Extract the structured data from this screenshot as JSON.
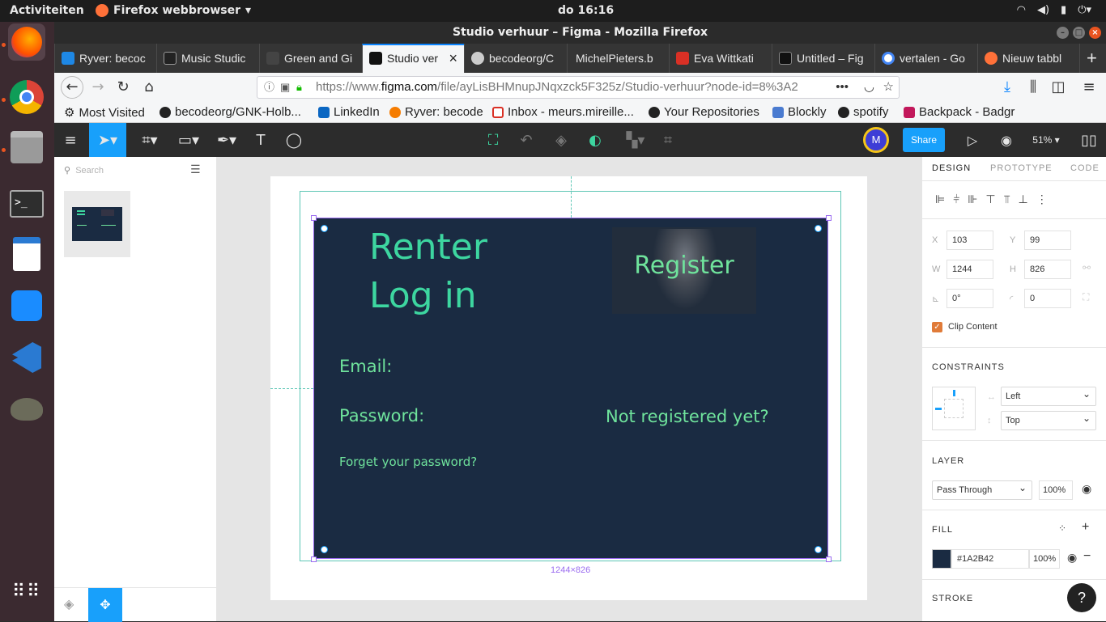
{
  "ubuntu": {
    "activities": "Activiteiten",
    "app_name": "Firefox webbrowser",
    "clock": "do 16:16"
  },
  "window": {
    "title": "Studio verhuur – Figma - Mozilla Firefox"
  },
  "tabs": [
    {
      "label": "Ryver: becoc",
      "color": "#1e88e5"
    },
    {
      "label": "Music Studic",
      "color": "#222222"
    },
    {
      "label": "Green and Gi",
      "color": "#444444"
    },
    {
      "label": "Studio ver",
      "color": "#111111",
      "active": true
    },
    {
      "label": "becodeorg/C",
      "color": "#cccccc"
    },
    {
      "label": "MichelPieters.b",
      "color": "#cccccc"
    },
    {
      "label": "Eva Wittkati",
      "color": "#d93025"
    },
    {
      "label": "Untitled – Fig",
      "color": "#111111"
    },
    {
      "label": "vertalen - Go",
      "color": "#4285f4"
    },
    {
      "label": "Nieuw tabbl",
      "color": "#ff7139"
    }
  ],
  "nav": {
    "url_prefix": "https://www.",
    "url_domain": "figma.com",
    "url_path": "/file/ayLisBHMnupJNqxzck5F325z/Studio-verhuur?node-id=8%3A2"
  },
  "bookmarks": [
    {
      "label": "Most Visited",
      "color": "#555555"
    },
    {
      "label": "becodeorg/GNK-Holb...",
      "color": "#222222"
    },
    {
      "label": "LinkedIn",
      "color": "#0a66c2"
    },
    {
      "label": "Ryver: becode",
      "color": "#f57c00"
    },
    {
      "label": "Inbox - meurs.mireille...",
      "color": "#d93025"
    },
    {
      "label": "Your Repositories",
      "color": "#222222"
    },
    {
      "label": "Blockly",
      "color": "#4a7bd0"
    },
    {
      "label": "spotify",
      "color": "#222222"
    },
    {
      "label": "Backpack - Badgr",
      "color": "#c2185b"
    }
  ],
  "figma_toolbar": {
    "avatar_initial": "M",
    "share_label": "Share",
    "zoom": "51%"
  },
  "layers_panel": {
    "search_placeholder": "Search"
  },
  "canvas": {
    "frame": {
      "title_line1": "Renter",
      "title_line2": "Log in",
      "register": "Register",
      "email_label": "Email:",
      "password_label": "Password:",
      "not_registered": "Not registered yet?",
      "forgot": "Forget your password?",
      "background": "#1A2B42"
    },
    "dimensions": "1244×826"
  },
  "design_panel": {
    "tabs": [
      "DESIGN",
      "PROTOTYPE",
      "CODE"
    ],
    "x_label": "X",
    "x": "103",
    "y_label": "Y",
    "y": "99",
    "w_label": "W",
    "w": "1244",
    "h_label": "H",
    "h": "826",
    "rotation": "0°",
    "radius": "0",
    "clip_content": "Clip Content",
    "constraints_title": "CONSTRAINTS",
    "constraint_h": "Left",
    "constraint_v": "Top",
    "layer_title": "LAYER",
    "blend": "Pass Through",
    "opacity": "100%",
    "fill_title": "FILL",
    "fill_hex": "#1A2B42",
    "fill_opacity": "100%",
    "stroke_title": "STROKE"
  },
  "help": "?"
}
